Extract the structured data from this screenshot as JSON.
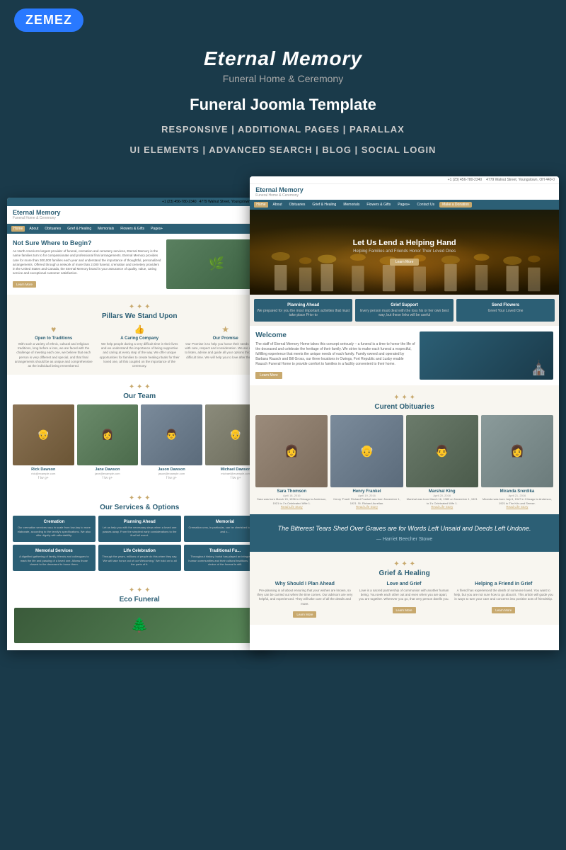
{
  "header": {
    "logo": "ZEMEZ",
    "title": "Eternal Memory",
    "subtitle": "Funeral Home & Ceremony",
    "template_label": "Funeral Joomla Template"
  },
  "features": {
    "line1": "RESPONSIVE  |  ADDITIONAL PAGES  |  PARALLAX",
    "line2": "UI ELEMENTS  |  ADVANCED SEARCH  |  BLOG  |  SOCIAL LOGIN"
  },
  "nav": {
    "items": [
      "Home",
      "About",
      "Obituaries",
      "Grief & Healing",
      "Memorials",
      "Flowers & Gifts",
      "Pages+",
      "Contact Us"
    ],
    "cta": "Make a Donation"
  },
  "hero": {
    "headline": "Let Us Lend a Helping Hand",
    "subtext": "Helping Families and Friends Honor Their Loved Ones",
    "btn": "Learn More"
  },
  "service_cards": [
    {
      "title": "Planning Ahead",
      "text": "We prepared for you the most important activities that must take place Prior to"
    },
    {
      "title": "Grief Support",
      "text": "Every person must deal with the loss his or her own best way, but these links will be useful"
    },
    {
      "title": "Send Flowers",
      "text": "Greet Your Loved One"
    }
  ],
  "welcome": {
    "title": "Welcome",
    "text": "The staff of Eternal Memory Home takes this concept seriously – a funeral is a time to honor the life of the deceased and celebrate the heritage of their family. We strive to make each funeral a respectful, fulfilling experience that meets the unique needs of each family. Family owned and operated by Barbara Rausch and Bill Gross, our three locations in Owings, Fort Republic and Lusby enable Rausch Funeral Home to provide comfort to families in a facility convenient to their home.",
    "btn": "Learn More"
  },
  "not_sure": {
    "title": "Not Sure Where to Begin?",
    "text": "As North America's largest provider of funeral, cremation and cemetery services, Eternal Memory is the name families turn to for compassionate and professional final arrangements. Eternal Memory provides care for more than 300,000 families each year and understand the importance of thoughtful, personalized arrangements. Offered through a network of more than 2,000 funeral, cremation and cemetery providers in the United States and Canada, the Eternal Memory brand is your assurance of quality, value, caring service and exceptional customer satisfaction.",
    "btn": "Learn More"
  },
  "pillars": {
    "title": "Pillars We Stand Upon",
    "items": [
      {
        "icon": "♥",
        "title": "Open to Traditions",
        "text": "With such a variety of ethnic, cultural and religious traditions, long before a loss, we are faced with the challenge of meeting each one, we believe that each person is very different and special, and that final arrangements should be as unique and comprehensive as the individual being remembered."
      },
      {
        "icon": "👍",
        "title": "A Caring Company",
        "text": "We help people during a very difficult time in their lives and we understand the importance of being supportive and caring at every step of the way. We offer unique opportunities for families to create healing rituals for their loved one, all this coupled on the importance of the ceremony."
      },
      {
        "icon": "★",
        "title": "Our Promise",
        "text": "Our Promise is to help you honor their needs in a funeral with care, respect and consideration. We are always here to listen, advise and guide all your options throughout this difficult time. We will help you to love after their dearest."
      }
    ]
  },
  "team": {
    "title": "Our Team",
    "members": [
      {
        "name": "Rick Dawson",
        "email": "rick@example.com",
        "photo_emoji": "👴"
      },
      {
        "name": "Jane Dawson",
        "email": "jane@example.com",
        "photo_emoji": "👩"
      },
      {
        "name": "Jason Dawson",
        "email": "jason@example.com",
        "photo_emoji": "👨"
      },
      {
        "name": "Michael Dawson",
        "email": "michael@example.com",
        "photo_emoji": "👴"
      }
    ]
  },
  "obituaries": {
    "title": "Curent Obituaries",
    "items": [
      {
        "name": "Sara Thomson",
        "dates": "April 18, 2016",
        "text": "Sara was born March 15, 1936 in Chicago to Anderson, 1921 to 1's Celebrated Wife 1.",
        "photo_emoji": "👩"
      },
      {
        "name": "Henry Frankel",
        "dates": "April 19, 2016",
        "text": "Henry 'Frank' Richard Frankel was born November 1, 1921. St. Richard Aurelian.",
        "photo_emoji": "👴"
      },
      {
        "name": "Marshal King",
        "dates": "April 20, 2016",
        "text": "Marshal was born March 16, 1989 on November 1, 1921 to 1's Celebrated Wife 1.",
        "photo_emoji": "👨"
      },
      {
        "name": "Miranda Srerdika",
        "dates": "April 21, 2016",
        "text": "Miranda was born July 6, 1947 in Chicago to Anderson, 1921 to The Kris and Semse.",
        "photo_emoji": "👩"
      }
    ],
    "link": "Read Life Story"
  },
  "quote": {
    "text": "The Bitterest Tears Shed Over Graves are\nfor Words Left Unsaid and Deeds Left Undone.",
    "attr": "— Harriet Beecher Stowe"
  },
  "services": {
    "title": "Our Services & Options",
    "items": [
      {
        "title": "Cremation",
        "text": "Our cremation services vary in scale from low-key to more elaborate, according to the family's specifications. We also offer dignity with affordability."
      },
      {
        "title": "Planning Ahead",
        "text": "Let us help you with the necessary steps when a loved one passes away. From the simplest early considerations to the final full event."
      },
      {
        "title": "Memorial",
        "text": "Cremation urns, in particular, can be cherished keepsakes and c..."
      },
      {
        "title": "Memorial Services",
        "text": "A dignified gathering of family, friends and colleagues to mark the life and passing of a loved one. Allows those closest to the deceased to honor them."
      },
      {
        "title": "Life Celebration",
        "text": "Through the years, millions of people do this when they say, 'We will take honor out of our Welcoming.' We hold on to all the parts of it."
      },
      {
        "title": "Traditional Fu...",
        "text": "Throughout history, burial has played an integral part in human communities and their cultural traditions. Today the choice of the funeral is still."
      }
    ]
  },
  "grief": {
    "title": "Grief & Healing",
    "columns": [
      {
        "title": "Why Should I Plan Ahead",
        "text": "Pre-planning is all about ensuring that your wishes are known, so they can be carried out when the time comes. Our advisors are very helpful, and experienced. They will take care of all the details and more.",
        "btn": "Learn More"
      },
      {
        "title": "Love and Grief",
        "text": "Love is a sacred partnership of communion with another human being. You seek each other out and even when you are apart, you are together. Wherever you go, that very person dwells you.",
        "btn": "Learn More"
      },
      {
        "title": "Helping a Friend in Grief",
        "text": "A friend has experienced the death of someone loved. You want to help, but you are not sure how to go about it. This article will guide you in ways to turn your care and concerns into positive acts of friendship.",
        "btn": "Learn More"
      }
    ]
  },
  "eco": {
    "title": "Eco Funeral",
    "photo_emoji": "🌲"
  },
  "colors": {
    "primary": "#2c5f75",
    "accent": "#c8a96e",
    "bg_light": "#f8f6f0",
    "text_dark": "#333333"
  }
}
